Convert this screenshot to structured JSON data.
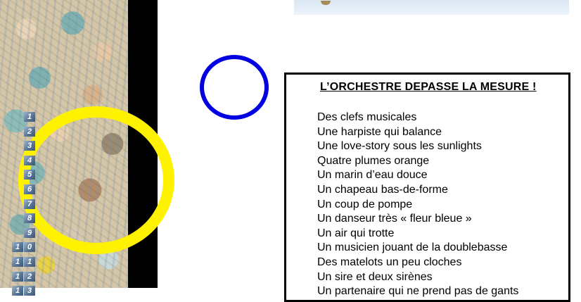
{
  "panel": {
    "title": "L’ORCHESTRE DEPASSE LA MESURE !",
    "items": [
      {
        "number": "1",
        "label": "Des clefs musicales"
      },
      {
        "number": "2",
        "label": "Une harpiste qui balance"
      },
      {
        "number": "3",
        "label": "Une love-story sous les sunlights"
      },
      {
        "number": "4",
        "label": "Quatre plumes orange"
      },
      {
        "number": "5",
        "label": "Un marin d’eau douce"
      },
      {
        "number": "6",
        "label": "Un chapeau bas-de-forme"
      },
      {
        "number": "7",
        "label": "Un coup de pompe"
      },
      {
        "number": "8",
        "label": "Un danseur très « fleur bleue »"
      },
      {
        "number": "9",
        "label": "Un air qui trotte"
      },
      {
        "number": "10",
        "label": "Un musicien jouant de la doublebasse"
      },
      {
        "number": "11",
        "label": "Des matelots un peu cloches"
      },
      {
        "number": "12",
        "label": "Un sire et deux sirènes"
      },
      {
        "number": "13",
        "label": "Un partenaire qui ne prend pas de gants"
      }
    ]
  },
  "annotations": {
    "yellow_circle_color": "#fff200",
    "blue_circle_color": "#0000e0"
  }
}
